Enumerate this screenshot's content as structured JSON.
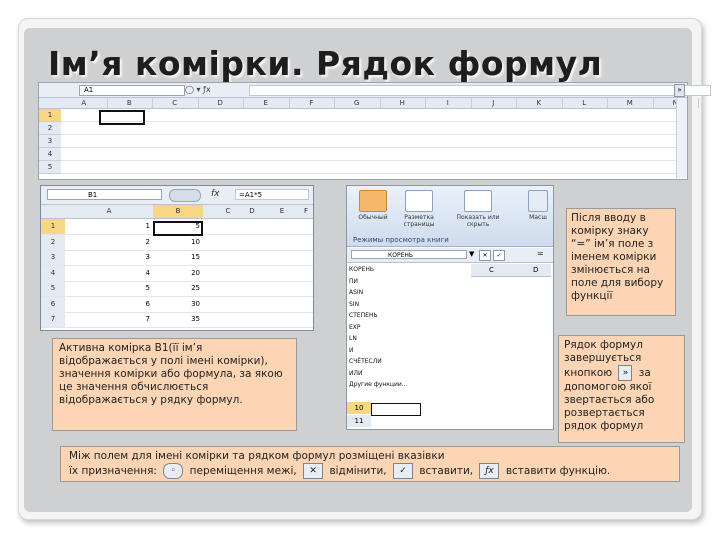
{
  "slide": {
    "title": "Ім’я комірки. Рядок формул"
  },
  "excel_top": {
    "name_box": "A1",
    "fx_icon": "fx",
    "columns": [
      "A",
      "B",
      "C",
      "D",
      "E",
      "F",
      "G",
      "H",
      "I",
      "J",
      "K",
      "L",
      "M",
      "N"
    ],
    "rows": [
      "1",
      "2",
      "3",
      "4",
      "5"
    ]
  },
  "excel_b1": {
    "name_box": "B1",
    "fx_icon": "fx",
    "formula": "=A1*5",
    "columns": [
      "A",
      "B",
      "C",
      "D",
      "E",
      "F"
    ],
    "rows": [
      {
        "r": "1",
        "a": "1",
        "b": "5"
      },
      {
        "r": "2",
        "a": "2",
        "b": "10"
      },
      {
        "r": "3",
        "a": "3",
        "b": "15"
      },
      {
        "r": "4",
        "a": "4",
        "b": "20"
      },
      {
        "r": "5",
        "a": "5",
        "b": "25"
      },
      {
        "r": "6",
        "a": "6",
        "b": "30"
      },
      {
        "r": "7",
        "a": "7",
        "b": "35"
      }
    ]
  },
  "excel_func": {
    "ribbon": {
      "btn1": "Обычный",
      "btn2": "Разметка страницы",
      "btn3": "Показать или скрыть",
      "btn4": "Масш",
      "group_label": "Режимы просмотра книги"
    },
    "name_box": "КОРЕНЬ",
    "eq": "=",
    "col_c": "C",
    "col_d": "D",
    "functions": [
      "КОРЕНЬ",
      "ПИ",
      "ASIN",
      "SIN",
      "СТЕПЕНЬ",
      "EXP",
      "LN",
      "И",
      "СЧЁТЕСЛИ",
      "ИЛИ",
      "Другие функции..."
    ],
    "row10": "10",
    "row11": "11"
  },
  "callouts": {
    "right1": "Після вводу в комірку знаку “=” ім’я поле з іменем комірки змінюється  на поле для вибору функції",
    "right2_a": "Рядок формул завершується кнопкою",
    "right2_b": "за допомогою якої звертається або розвертається рядок формул",
    "left": "Активна комірка В1(її ім’я відображається у полі імені комірки), значення комірки або формула, за якою це значення обчислюється  відображається у рядку формул.",
    "bottom_line1": "Між полем для імені комірки та рядком формул розміщені вказівки",
    "bottom_prefix": "їх призначення:",
    "bottom_move": "переміщення межі,",
    "bottom_cancel": "відмінити,",
    "bottom_insert": "вставити,",
    "bottom_func": "вставити функцію."
  }
}
